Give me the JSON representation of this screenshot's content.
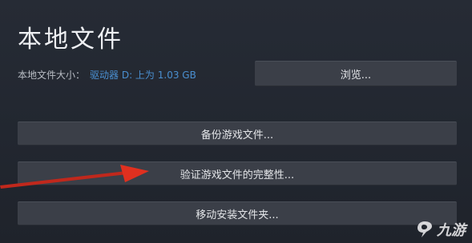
{
  "title": "本地文件",
  "size_label": "本地文件大小：",
  "size_value": "驱动器 D: 上为 1.03 GB",
  "buttons": {
    "browse": "浏览...",
    "backup": "备份游戏文件...",
    "verify": "验证游戏文件的完整性...",
    "move": "移动安装文件夹..."
  },
  "watermark": "九游",
  "colors": {
    "background": "#232831",
    "button": "#3b3f48",
    "link_blue": "#4a8fd0",
    "arrow_red": "#d42b1e"
  },
  "icons": {
    "watermark_logo": "jiuyou-logo-icon",
    "annotation_arrow": "red-arrow-icon"
  }
}
